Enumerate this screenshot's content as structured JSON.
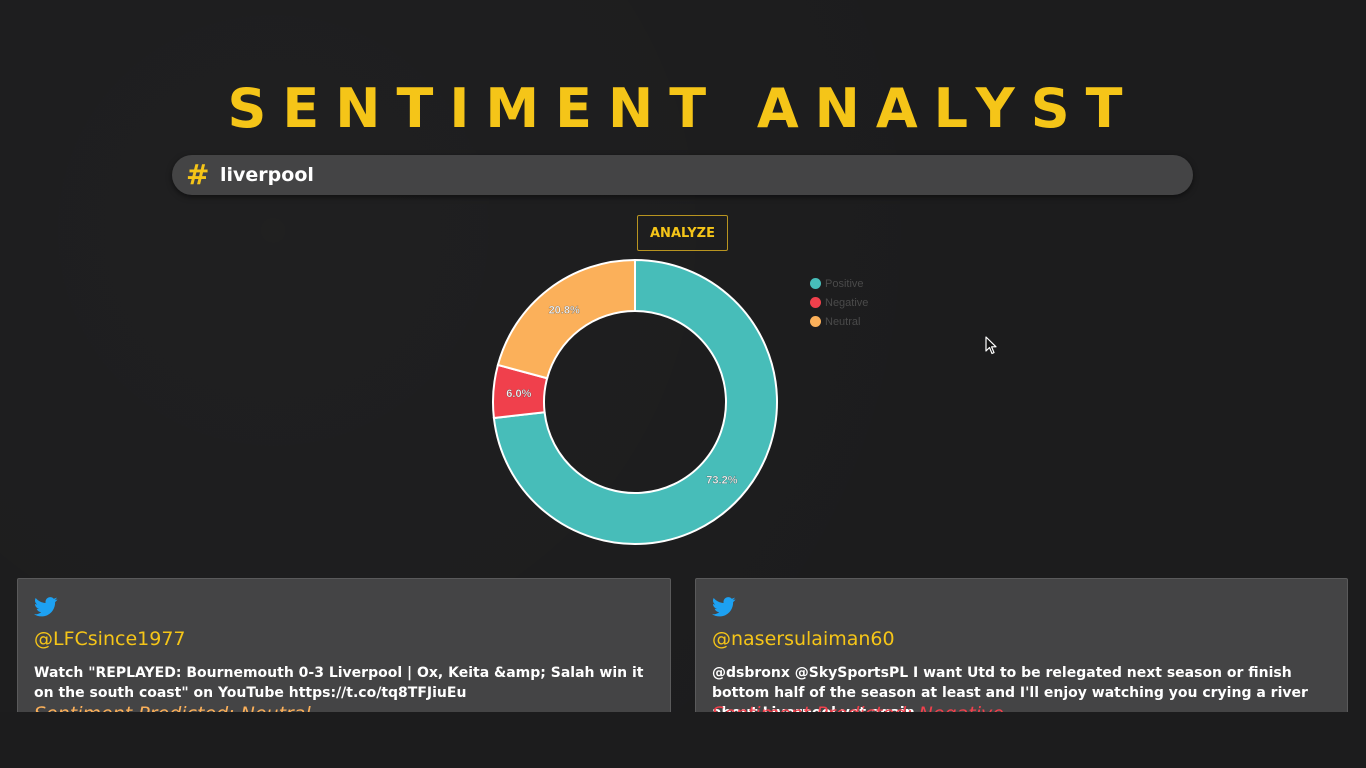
{
  "app": {
    "title": "SENTIMENT ANALYST"
  },
  "search": {
    "value": "liverpool",
    "icon": "hash-icon"
  },
  "analyze_button": {
    "label": "ANALYZE"
  },
  "colors": {
    "accent": "#f5c518",
    "positive": "#47bdb9",
    "negative": "#f0404c",
    "neutral": "#fbb05a",
    "twitter": "#1da1f2"
  },
  "chart_data": {
    "type": "pie",
    "donut": true,
    "categories": [
      "Positive",
      "Negative",
      "Neutral"
    ],
    "values": [
      73.2,
      6.0,
      20.8
    ],
    "value_labels": [
      "73.2%",
      "6.0%",
      "20.8%"
    ],
    "colors": [
      "#47bdb9",
      "#f0404c",
      "#fbb05a"
    ],
    "legend_position": "right"
  },
  "tweets": [
    {
      "icon": "twitter-bird-icon",
      "handle": "@LFCsince1977",
      "text": "Watch \"REPLAYED: Bournemouth 0-3 Liverpool | Ox, Keita &amp; Salah win it on the south coast\" on YouTube https://t.co/tq8TFJiuEu",
      "prediction": "Sentiment Predicted: Neutral",
      "prediction_color": "#fbb05a"
    },
    {
      "icon": "twitter-bird-icon",
      "handle": "@nasersulaiman60",
      "text": "@dsbronx @SkySportsPL I want Utd to be relegated next season or finish bottom half of the season at least and I'll enjoy watching you crying a river about Liverpool yet again.",
      "prediction": "Sentiment Predicted: Negative",
      "prediction_color": "#f0404c"
    }
  ]
}
